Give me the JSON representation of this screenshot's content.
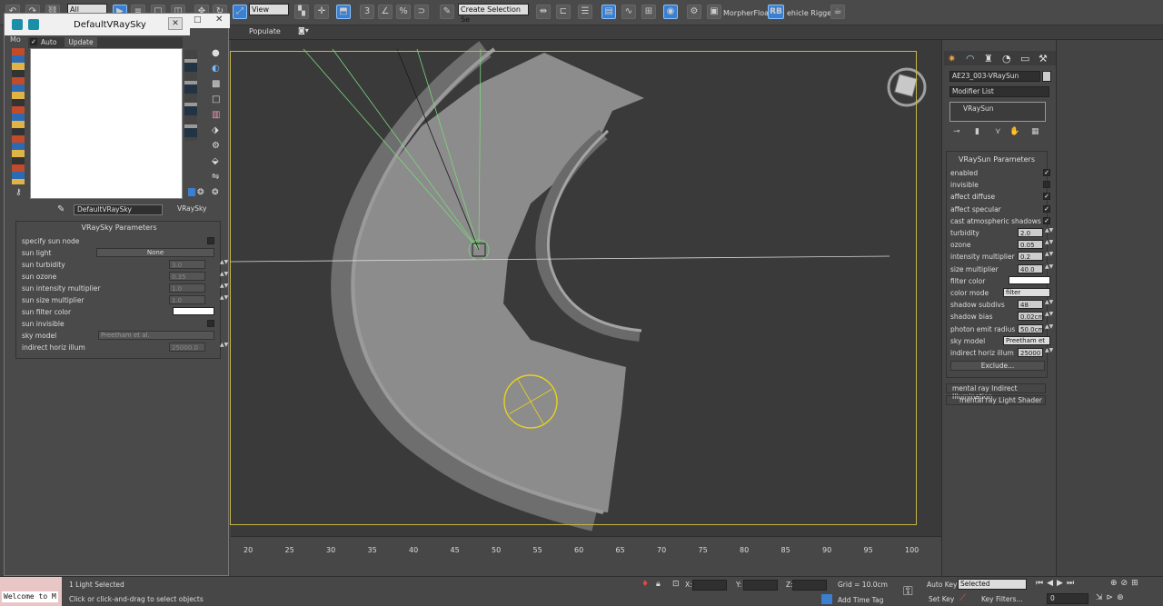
{
  "toolbar": {
    "filter_value": "All",
    "view_value": "View",
    "selection_set_placeholder": "Create Selection Se",
    "plugin_morpher": "MorpherFloater",
    "plugin_rb": "RB",
    "plugin_vehicle": "ehicle Rigger 1"
  },
  "ribbon": {
    "populate_label": "Populate"
  },
  "dialog": {
    "title": "DefaultVRaySky",
    "tab_label": "Mo",
    "auto_label": "Auto",
    "update_label": "Update",
    "map_name": "DefaultVRaySky",
    "map_type": "VRaySky",
    "rollout_title": "VRaySky Parameters",
    "params": [
      {
        "label": "specify sun node",
        "type": "check",
        "value": ""
      },
      {
        "label": "sun light",
        "type": "button",
        "value": "None"
      },
      {
        "label": "sun turbidity",
        "type": "spin",
        "value": "3.0"
      },
      {
        "label": "sun ozone",
        "type": "spin",
        "value": "0.35"
      },
      {
        "label": "sun intensity multiplier",
        "type": "spin",
        "value": "1.0"
      },
      {
        "label": "sun size multiplier",
        "type": "spin",
        "value": "1.0"
      },
      {
        "label": "sun filter color",
        "type": "color",
        "value": ""
      },
      {
        "label": "sun invisible",
        "type": "check",
        "value": ""
      },
      {
        "label": "sky model",
        "type": "select",
        "value": "Preetham et al."
      },
      {
        "label": "indirect horiz illum",
        "type": "spin",
        "value": "25000.0"
      }
    ]
  },
  "command_panel": {
    "object_name": "AE23_003-VRaySun",
    "modifier_list": "Modifier List",
    "stack_item": "VRaySun",
    "rollout_title": "VRaySun Parameters",
    "params": [
      {
        "label": "enabled",
        "type": "check",
        "checked": "✓"
      },
      {
        "label": "invisible",
        "type": "check",
        "checked": ""
      },
      {
        "label": "affect diffuse",
        "type": "check",
        "checked": "✓"
      },
      {
        "label": "affect specular",
        "type": "check",
        "checked": "✓"
      },
      {
        "label": "cast atmospheric shadows",
        "type": "check",
        "checked": "✓"
      },
      {
        "label": "turbidity",
        "type": "spin",
        "value": "2.0"
      },
      {
        "label": "ozone",
        "type": "spin",
        "value": "0.05"
      },
      {
        "label": "intensity multiplier",
        "type": "spin",
        "value": "0.2"
      },
      {
        "label": "size multiplier",
        "type": "spin",
        "value": "40.0"
      },
      {
        "label": "filter color",
        "type": "color",
        "value": ""
      },
      {
        "label": "color mode",
        "type": "select",
        "value": "filter"
      },
      {
        "label": "shadow subdivs",
        "type": "spin",
        "value": "48"
      },
      {
        "label": "shadow bias",
        "type": "spin",
        "value": "0.02cm"
      },
      {
        "label": "photon emit radius",
        "type": "spin",
        "value": "50.0cm"
      },
      {
        "label": "sky model",
        "type": "select",
        "value": "Preetham et"
      },
      {
        "label": "indirect horiz illum",
        "type": "spin",
        "value": "25000"
      }
    ],
    "exclude_label": "Exclude...",
    "rollup_1": "mental ray Indirect Illumination",
    "rollup_2": "mental ray Light Shader"
  },
  "timeline": {
    "ticks": [
      "20",
      "25",
      "30",
      "35",
      "40",
      "45",
      "50",
      "55",
      "60",
      "65",
      "70",
      "75",
      "80",
      "85",
      "90",
      "95",
      "100"
    ]
  },
  "status": {
    "maxscript_text": "Welcome to M",
    "selection_info": "1 Light Selected",
    "prompt": "Click or click-and-drag to select objects",
    "x_label": "X:",
    "y_label": "Y:",
    "z_label": "Z:",
    "grid": "Grid = 10.0cm",
    "add_time_tag": "Add Time Tag",
    "auto_key": "Auto Key",
    "set_key": "Set Key",
    "selected_value": "Selected",
    "key_filters": "Key Filters...",
    "frame_value": "0"
  },
  "colors": {
    "accent": "#3a7fd0",
    "viewport_border": "#c7b54a",
    "light_gizmo": "#e6d21e",
    "light_cone": "#7ad67a"
  }
}
